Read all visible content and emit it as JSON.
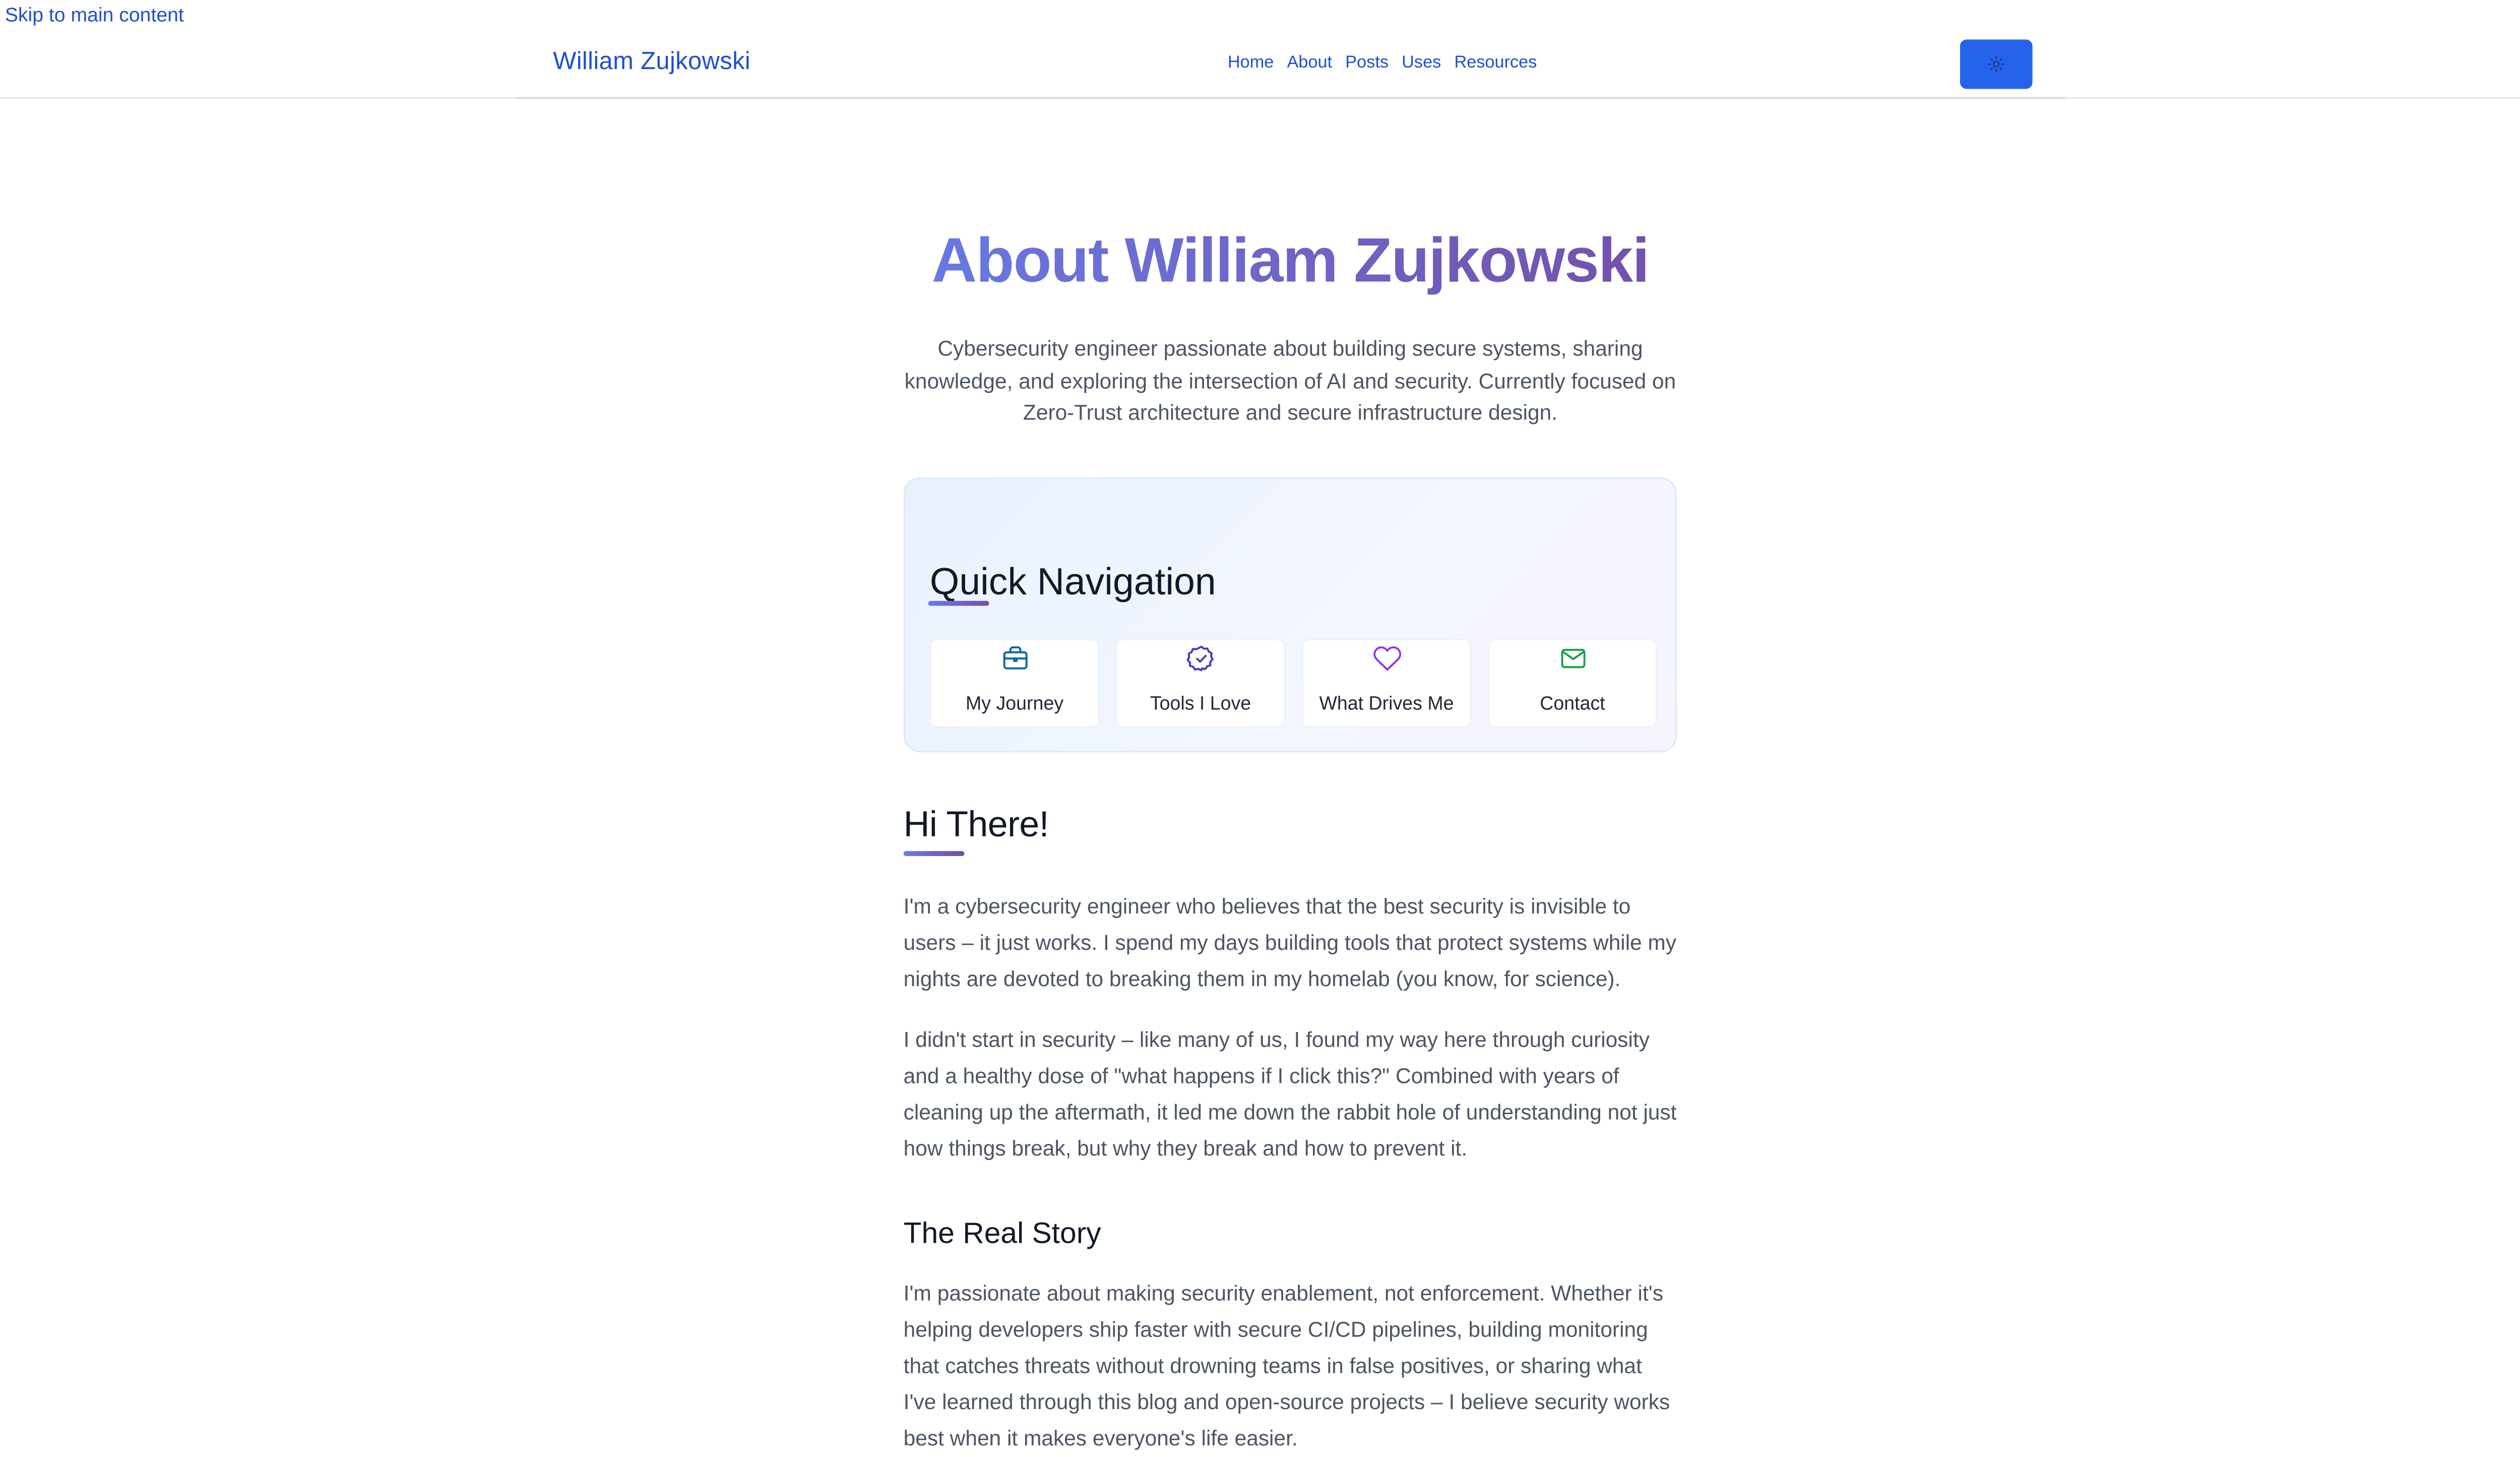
{
  "skip_link": "Skip to main content",
  "header": {
    "brand": "William Zujkowski",
    "nav": [
      "Home",
      "About",
      "Posts",
      "Uses",
      "Resources"
    ],
    "theme_toggle_icon": "sun-icon"
  },
  "page": {
    "title": "About William Zujkowski",
    "intro": "Cybersecurity engineer passionate about building secure systems, sharing knowledge, and exploring the intersection of AI and security. Currently focused on Zero-Trust architecture and secure infrastructure design."
  },
  "quick_nav": {
    "title": "Quick Navigation",
    "items": [
      {
        "label": "My Journey",
        "icon": "briefcase-icon",
        "color": "#0369a1"
      },
      {
        "label": "Tools I Love",
        "icon": "check-badge-icon",
        "color": "#4338ca"
      },
      {
        "label": "What Drives Me",
        "icon": "heart-icon",
        "color": "#9333ea"
      },
      {
        "label": "Contact",
        "icon": "mail-icon",
        "color": "#16a34a"
      }
    ]
  },
  "sections": {
    "hi_there": {
      "heading": "Hi There!",
      "paragraphs": [
        "I'm a cybersecurity engineer who believes that the best security is invisible to users – it just works. I spend my days building tools that protect systems while my nights are devoted to breaking them in my homelab (you know, for science).",
        "I didn't start in security – like many of us, I found my way here through curiosity and a healthy dose of \"what happens if I click this?\" Combined with years of cleaning up the aftermath, it led me down the rabbit hole of understanding not just how things break, but why they break and how to prevent it."
      ]
    },
    "real_story": {
      "heading": "The Real Story",
      "paragraphs": [
        "I'm passionate about making security enablement, not enforcement. Whether it's helping developers ship faster with secure CI/CD pipelines, building monitoring that catches threats without drowning teams in false positives, or sharing what I've learned through this blog and open-source projects – I believe security works best when it makes everyone's life easier."
      ]
    }
  },
  "colors": {
    "link": "#1d4ed8",
    "accent_gradient_start": "#667eea",
    "accent_gradient_end": "#764ba2",
    "theme_button": "#2563eb"
  }
}
